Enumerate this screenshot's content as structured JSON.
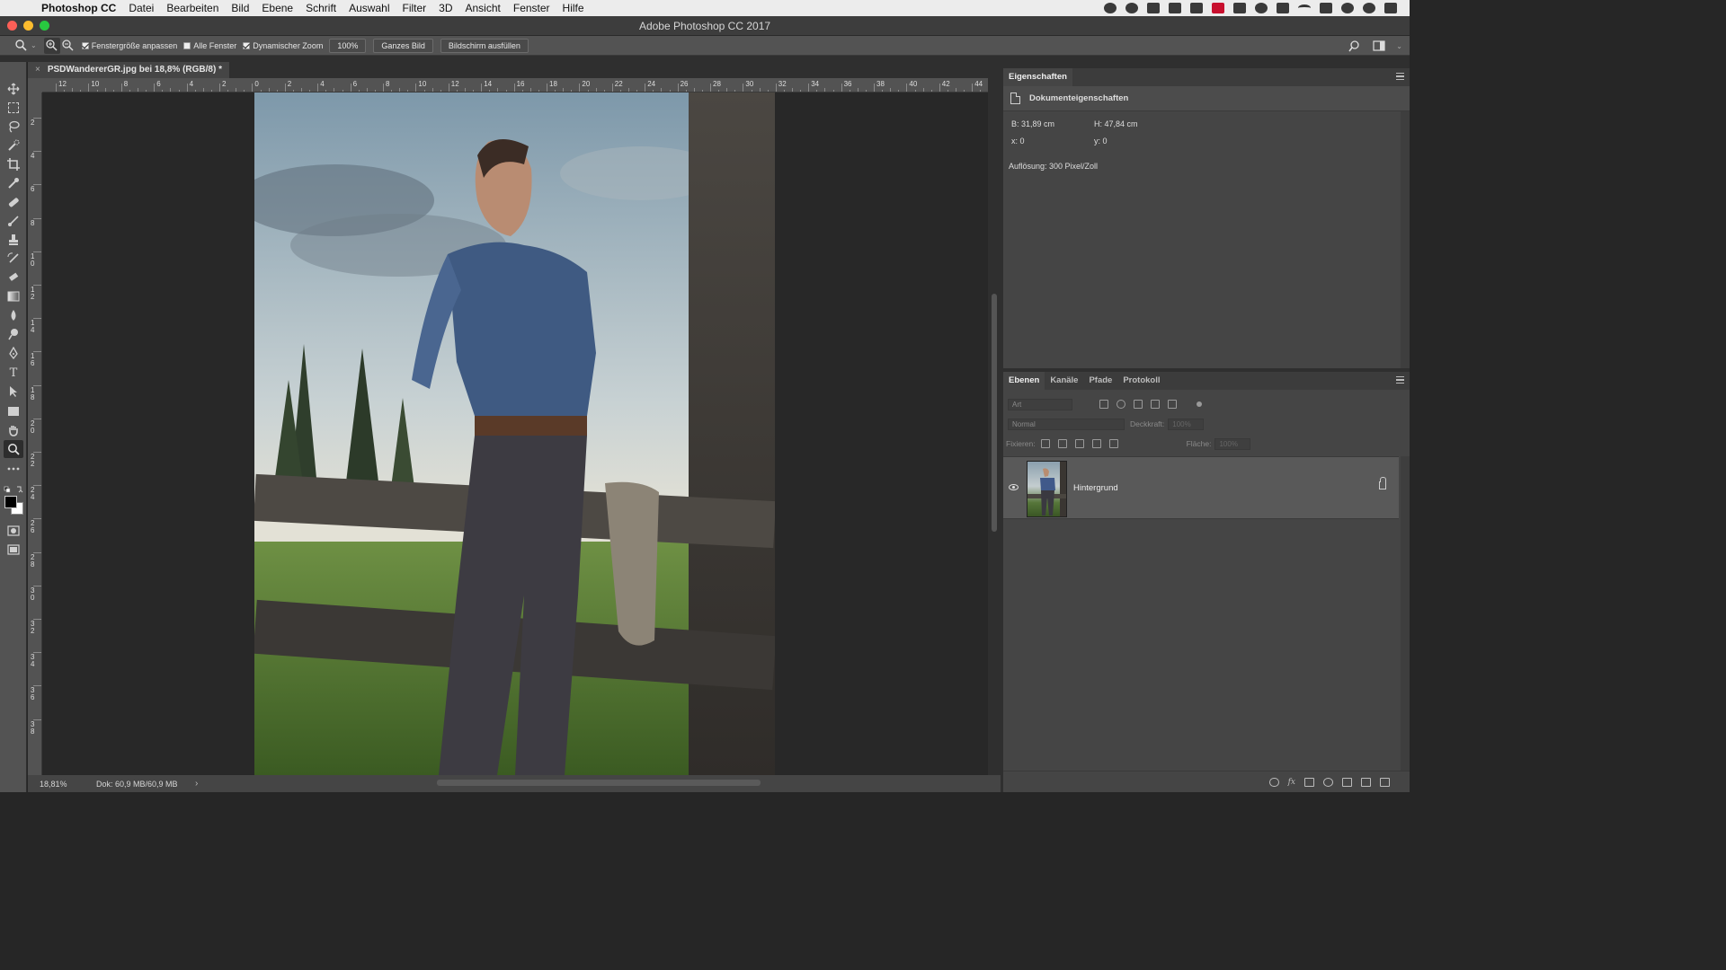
{
  "menubar": {
    "apple_glyph": "",
    "items": [
      "Photoshop CC",
      "Datei",
      "Bearbeiten",
      "Bild",
      "Ebene",
      "Schrift",
      "Auswahl",
      "Filter",
      "3D",
      "Ansicht",
      "Fenster",
      "Hilfe"
    ]
  },
  "window": {
    "title": "Adobe Photoshop CC 2017",
    "traffic_colors": [
      "#fc5f57",
      "#fdbc2e",
      "#28c840"
    ]
  },
  "options": {
    "resize_windows": "Fenstergröße anpassen",
    "all_windows": "Alle Fenster",
    "scrubby_zoom": "Dynamischer Zoom",
    "zoom_100": "100%",
    "fit_screen": "Ganzes Bild",
    "fill_screen": "Bildschirm ausfüllen",
    "checked": {
      "resize_windows": true,
      "all_windows": false,
      "scrubby_zoom": true
    }
  },
  "document": {
    "tab_title": "PSDWandererGR.jpg bei 18,8% (RGB/8) *",
    "tab_close": "×"
  },
  "rulers": {
    "h_labels": [
      "12",
      "10",
      "8",
      "6",
      "4",
      "2",
      "0",
      "2",
      "4",
      "6",
      "8",
      "10",
      "12",
      "14",
      "16",
      "18",
      "20",
      "22",
      "24",
      "26",
      "28",
      "30",
      "32",
      "34",
      "36",
      "38",
      "40",
      "42",
      "44"
    ],
    "v_labels": [
      "2",
      "4",
      "6",
      "8",
      "1 0",
      "1 2",
      "1 4",
      "1 6",
      "1 8",
      "2 0",
      "2 2",
      "2 4",
      "2 6",
      "2 8",
      "3 0",
      "3 2",
      "3 4",
      "3 6",
      "3 8"
    ]
  },
  "status": {
    "zoom": "18,81%",
    "doc": "Dok: 60,9 MB/60,9 MB",
    "arrow": "›"
  },
  "properties": {
    "header": "Eigenschaften",
    "sub": "Dokumenteigenschaften",
    "width_label": "B:",
    "width_value": "31,89 cm",
    "height_label": "H:",
    "height_value": "47,84 cm",
    "x_label": "x:",
    "x_value": "0",
    "y_label": "y:",
    "y_value": "0",
    "resolution": "Auflösung: 300 Pixel/Zoll"
  },
  "layers_panel": {
    "tabs": [
      "Ebenen",
      "Kanäle",
      "Pfade",
      "Protokoll"
    ],
    "filter_placeholder": "Art",
    "blend_mode": "Normal",
    "opacity_label": "Deckkraft:",
    "opacity_value": "100%",
    "lock_label": "Fixieren:",
    "fill_label": "Fläche:",
    "fill_value": "100%",
    "layers": [
      {
        "name": "Hintergrund",
        "visible": true,
        "locked": true
      }
    ]
  },
  "colors": {
    "accent_panel": "#454545",
    "ui_dark": "#2f2f2f"
  }
}
